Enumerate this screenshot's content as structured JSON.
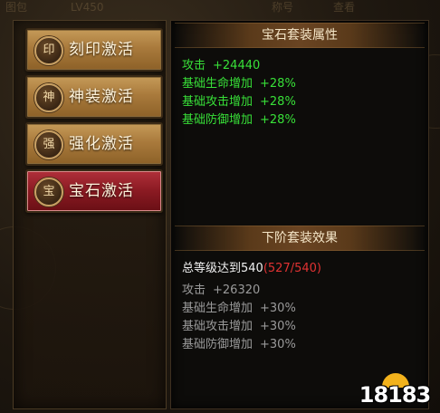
{
  "background": {
    "header_left": "图包",
    "header_level": "LV450",
    "header_mid": "称号",
    "header_right": "查看"
  },
  "sets": [
    {
      "icon_char": "印",
      "label": "刻印激活",
      "active": false
    },
    {
      "icon_char": "神",
      "label": "神装激活",
      "active": false
    },
    {
      "icon_char": "强",
      "label": "强化激活",
      "active": false
    },
    {
      "icon_char": "宝",
      "label": "宝石激活",
      "active": true
    }
  ],
  "current": {
    "title": "宝石套装属性",
    "attributes": [
      {
        "name": "攻击",
        "value": "+24440"
      },
      {
        "name": "基础生命增加",
        "value": "+28%"
      },
      {
        "name": "基础攻击增加",
        "value": "+28%"
      },
      {
        "name": "基础防御增加",
        "value": "+28%"
      }
    ]
  },
  "next": {
    "title": "下阶套装效果",
    "requirement_text": "总等级达到540",
    "requirement_progress": "(527/540)",
    "attributes": [
      {
        "name": "攻击",
        "value": "+26320"
      },
      {
        "name": "基础生命增加",
        "value": "+30%"
      },
      {
        "name": "基础攻击增加",
        "value": "+30%"
      },
      {
        "name": "基础防御增加",
        "value": "+30%"
      }
    ]
  },
  "watermark": "18183",
  "colors": {
    "active_attr": "#38e038",
    "inactive_attr": "#9a9a9a",
    "progress": "#e03232",
    "active_button": "#8a1a22",
    "inactive_button": "#a97a3c"
  }
}
